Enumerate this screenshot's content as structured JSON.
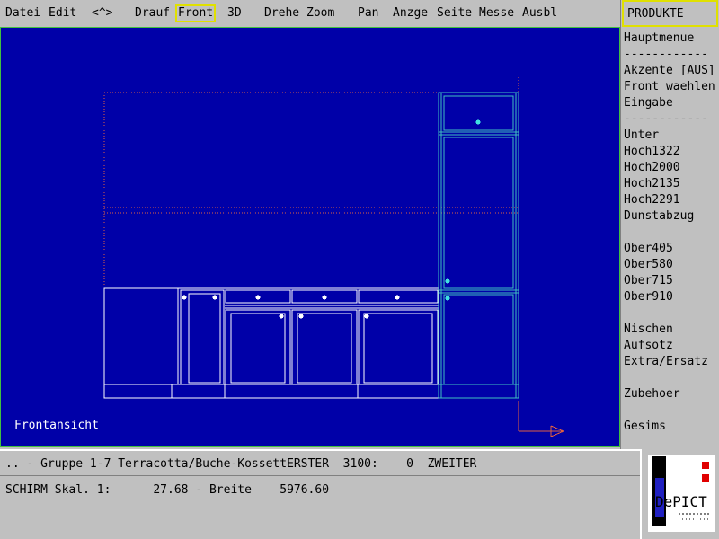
{
  "menubar": {
    "items": [
      {
        "label": "Datei"
      },
      {
        "label": "Edit"
      },
      {
        "label": "<^>"
      },
      {
        "label": "Drauf"
      },
      {
        "label": "Front"
      },
      {
        "label": "3D"
      },
      {
        "label": "Drehe"
      },
      {
        "label": "Zoom"
      },
      {
        "label": "Pan"
      },
      {
        "label": "Anzge"
      },
      {
        "label": "Seite"
      },
      {
        "label": "Messe"
      },
      {
        "label": "Ausbl"
      }
    ],
    "active_item": "Front"
  },
  "viewport": {
    "label": "Frontansicht",
    "background": "#0000a8",
    "line_color_cabinets": "#ffffff",
    "line_color_tall_cabinet": "#40c0c0",
    "line_color_guides": "#e06040",
    "axis_color": "#e06040"
  },
  "sidebar": {
    "title": "PRODUKTE",
    "items": [
      "Hauptmenue",
      "------------",
      "Akzente [AUS]",
      "Front waehlen",
      "Eingabe",
      "------------",
      "Unter",
      "Hoch1322",
      "Hoch2000",
      "Hoch2135",
      "Hoch2291",
      "Dunstabzug",
      "Ober405",
      "Ober580",
      "Ober715",
      "Ober910",
      "Nischen",
      "Aufsotz",
      "Extra/Ersatz",
      "Zubehoer",
      "Gesims"
    ]
  },
  "status": {
    "line1": ".. - Gruppe 1-7 Terracotta/Buche-KossettERSTER  3100:    0  ZWEITER",
    "line2": "SCHIRM Skal. 1:      27.68 - Breite    5976.60"
  },
  "logo": {
    "text": "DePICT",
    "colors": {
      "red": "#e00000",
      "blue": "#2020c0",
      "black": "#000000"
    }
  }
}
